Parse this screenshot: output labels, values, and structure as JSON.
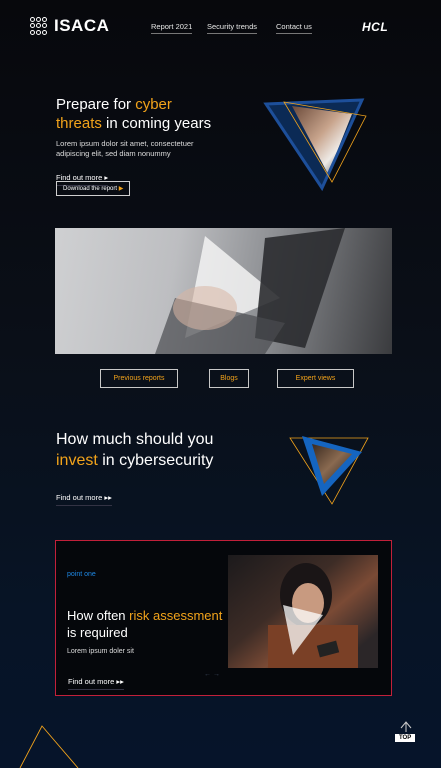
{
  "header": {
    "logo_text": "ISACA",
    "nav": [
      "Report 2021",
      "Security trends",
      "Contact us"
    ],
    "partner_logo": "HCL"
  },
  "hero": {
    "title_accent": "Prepare for ",
    "title_hl1": "cyber",
    "title_mid": "threats",
    "title_end": " in coming years",
    "body": "Lorem ipsum dolor sit amet, consectetuer adipiscing elit, sed diam nonummy",
    "find_out_more": "Find out more",
    "download_button": "Download the report"
  },
  "tabs": [
    "Previous reports",
    "Blogs",
    "Expert views"
  ],
  "invest": {
    "line1": "How much should you",
    "accent": "invest",
    "line2_end": " in cybersecurity",
    "find_out_more": "Find out more"
  },
  "card": {
    "eyebrow": "point one",
    "title_start": "How often ",
    "title_accent": "risk assessment",
    "title_end": " is required",
    "body": "Lorem ipsum doler sit",
    "find_out_more": "Find out more",
    "pager": "← →"
  },
  "top_button": "TOP",
  "colors": {
    "accent": "#f2a31b",
    "card_border": "#c2203a",
    "blue": "#1565c0"
  }
}
